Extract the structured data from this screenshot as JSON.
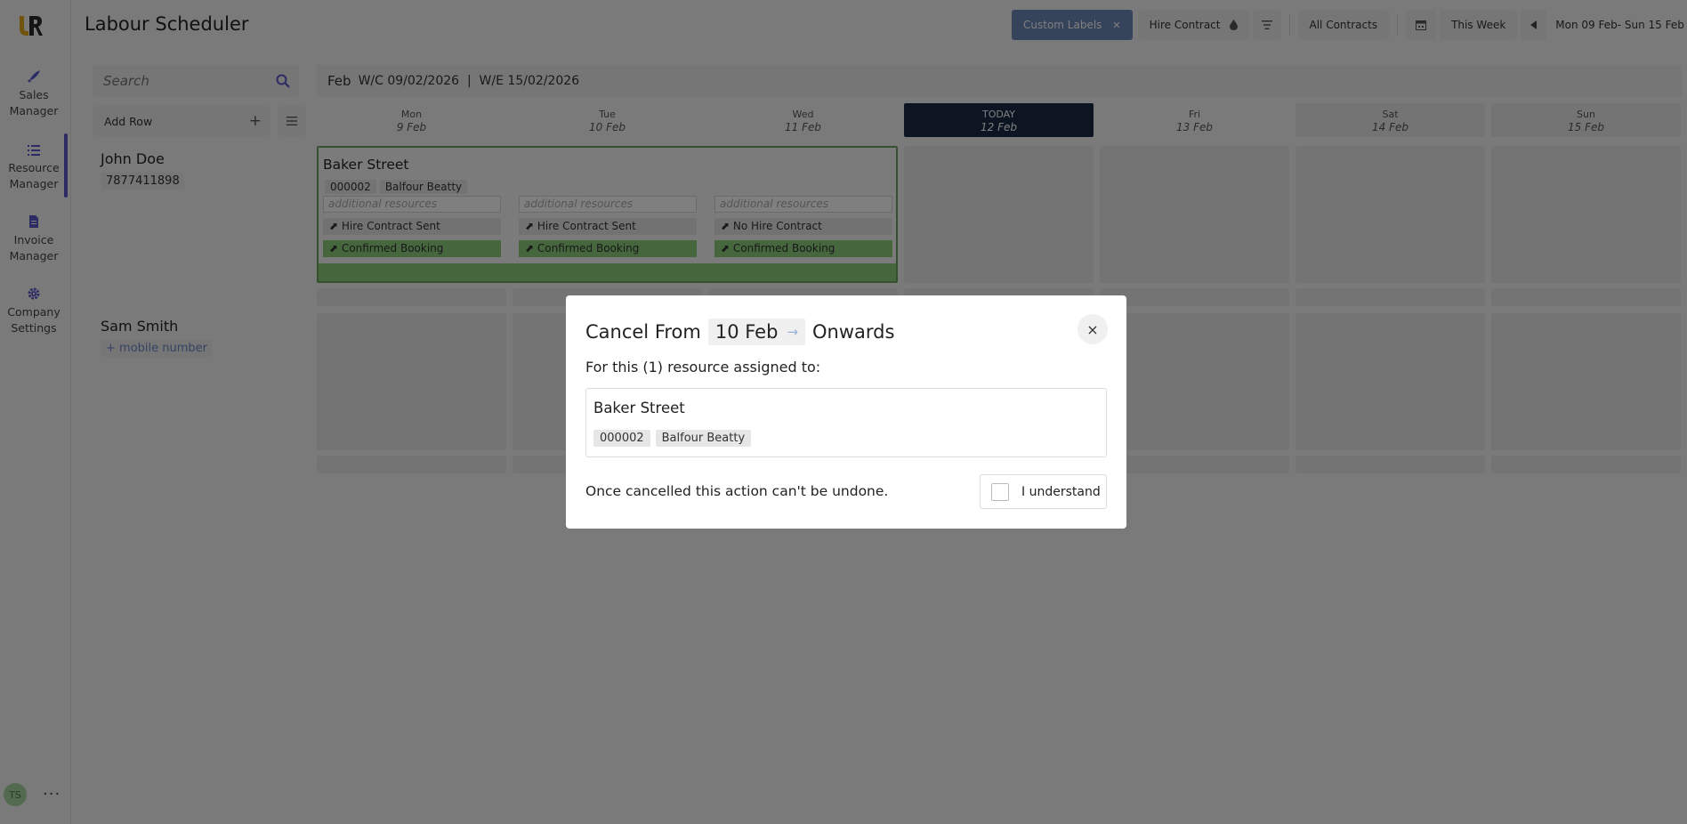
{
  "app": {
    "title": "Labour Scheduler",
    "logo": "UR"
  },
  "sidebar": {
    "items": [
      {
        "label": "Sales Manager",
        "icon": "rocket-icon"
      },
      {
        "label": "Resource Manager",
        "icon": "list-icon"
      },
      {
        "label": "Invoice Manager",
        "icon": "document-icon"
      },
      {
        "label": "Company Settings",
        "icon": "gear-icon"
      }
    ],
    "avatar": "TS",
    "more": "···"
  },
  "toolbar": {
    "custom_labels": "Custom Labels",
    "custom_labels_close": "✕",
    "hire_contract": "Hire Contract",
    "all_contracts": "All Contracts",
    "this_week": "This Week",
    "date_range": "Mon 09 Feb- Sun 15 Feb"
  },
  "search": {
    "placeholder": "Search"
  },
  "add_row": {
    "label": "Add Row",
    "plus": "+"
  },
  "week": {
    "month": "Feb",
    "range": "W/C 09/02/2026  |  W/E 15/02/2026"
  },
  "days": [
    {
      "name": "Mon",
      "date": "9 Feb"
    },
    {
      "name": "Tue",
      "date": "10 Feb"
    },
    {
      "name": "Wed",
      "date": "11 Feb"
    },
    {
      "name": "TODAY",
      "date": "12 Feb"
    },
    {
      "name": "Fri",
      "date": "13 Feb"
    },
    {
      "name": "Sat",
      "date": "14 Feb"
    },
    {
      "name": "Sun",
      "date": "15 Feb"
    }
  ],
  "people": [
    {
      "name": "John Doe",
      "phone": "7877411898"
    },
    {
      "name": "Sam Smith",
      "phone": "+ mobile number"
    }
  ],
  "booking": {
    "title": "Baker Street",
    "code": "000002",
    "client": "Balfour Beatty",
    "placeholder": "additional resources",
    "days": [
      {
        "contract": "Hire Contract Sent",
        "status": "Confirmed Booking"
      },
      {
        "contract": "Hire Contract Sent",
        "status": "Confirmed Booking"
      },
      {
        "contract": "No Hire Contract",
        "status": "Confirmed Booking"
      }
    ]
  },
  "modal": {
    "title_prefix": "Cancel From",
    "date": "10 Feb",
    "arrow": "→",
    "title_suffix": "Onwards",
    "close": "×",
    "subtitle": "For this (1) resource assigned to:",
    "assign_title": "Baker Street",
    "assign_code": "000002",
    "assign_client": "Balfour Beatty",
    "warning": "Once cancelled this action can't be undone.",
    "understand": "I understand"
  }
}
